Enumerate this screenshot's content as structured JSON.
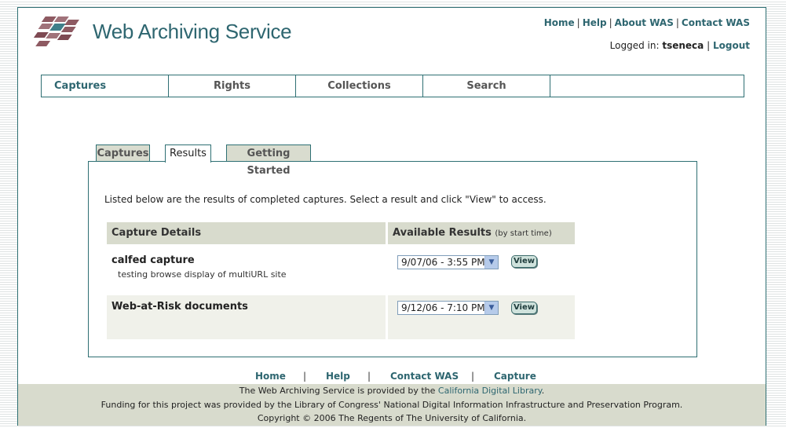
{
  "header": {
    "brand": "Web Archiving Service",
    "links": [
      "Home",
      "Help",
      "About WAS",
      "Contact WAS"
    ],
    "login_prefix": "Logged in:",
    "user": "tseneca",
    "logout": "Logout"
  },
  "nav": [
    "Captures",
    "Rights",
    "Collections",
    "Search"
  ],
  "tabs": [
    "Captures",
    "Results",
    "Getting Started"
  ],
  "content": {
    "intro": "Listed below are the results of completed captures. Select a result and click \"View\" to access.",
    "headers": {
      "details": "Capture Details",
      "results": "Available Results",
      "results_note": "(by start time)"
    },
    "rows": [
      {
        "title": "calfed capture",
        "desc": "testing browse display of multiURL site",
        "selected": "9/07/06 - 3:55 PM P",
        "button": "View"
      },
      {
        "title": "Web-at-Risk documents",
        "desc": "",
        "selected": "9/12/06 - 7:10 PM P",
        "button": "View"
      }
    ]
  },
  "bottom_links": [
    "Home",
    "Help",
    "Contact WAS",
    "Capture"
  ],
  "footer": {
    "line1_prefix": "The Web Archiving Service is provided by the",
    "line1_link": "California Digital Library",
    "line1_suffix": ".",
    "line2": "Funding for this project was provided by the Library of Congress' National Digital Information Infrastructure and Preservation Program.",
    "line3": "Copyright © 2006 The Regents of The University of California."
  },
  "colors": {
    "accent": "#2e6670",
    "border": "#2e6f73",
    "header_bg": "#d8dbcd",
    "row_bg": "#f0f1ea",
    "logo": "#7e4a53"
  }
}
